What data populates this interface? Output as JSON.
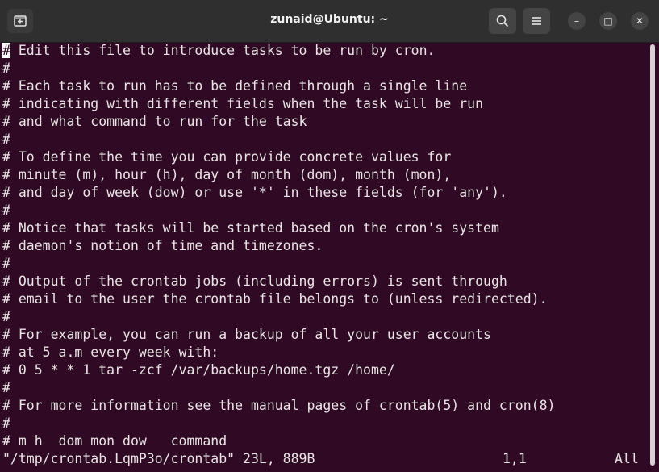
{
  "window": {
    "title": "zunaid@Ubuntu: ~",
    "buttons": {
      "minimize": "–",
      "maximize": "□",
      "close": "✕"
    }
  },
  "terminal": {
    "cursor_char": "#",
    "lines": [
      " Edit this file to introduce tasks to be run by cron.",
      "#",
      "# Each task to run has to be defined through a single line",
      "# indicating with different fields when the task will be run",
      "# and what command to run for the task",
      "#",
      "# To define the time you can provide concrete values for",
      "# minute (m), hour (h), day of month (dom), month (mon),",
      "# and day of week (dow) or use '*' in these fields (for 'any').",
      "#",
      "# Notice that tasks will be started based on the cron's system",
      "# daemon's notion of time and timezones.",
      "#",
      "# Output of the crontab jobs (including errors) is sent through",
      "# email to the user the crontab file belongs to (unless redirected).",
      "#",
      "# For example, you can run a backup of all your user accounts",
      "# at 5 a.m every week with:",
      "# 0 5 * * 1 tar -zcf /var/backups/home.tgz /home/",
      "#",
      "# For more information see the manual pages of crontab(5) and cron(8)",
      "#",
      "# m h  dom mon dow   command"
    ],
    "status": {
      "file": "\"/tmp/crontab.LqmP3o/crontab\" 23L, 889B",
      "position": "1,1",
      "scroll": "All"
    }
  },
  "colors": {
    "terminal_bg": "#300a24",
    "titlebar_bg": "#2f2f2f",
    "text": "#e8e6e4"
  },
  "icons": [
    "new-tab-icon",
    "search-icon",
    "hamburger-menu-icon",
    "minimize-icon",
    "maximize-icon",
    "close-icon"
  ]
}
